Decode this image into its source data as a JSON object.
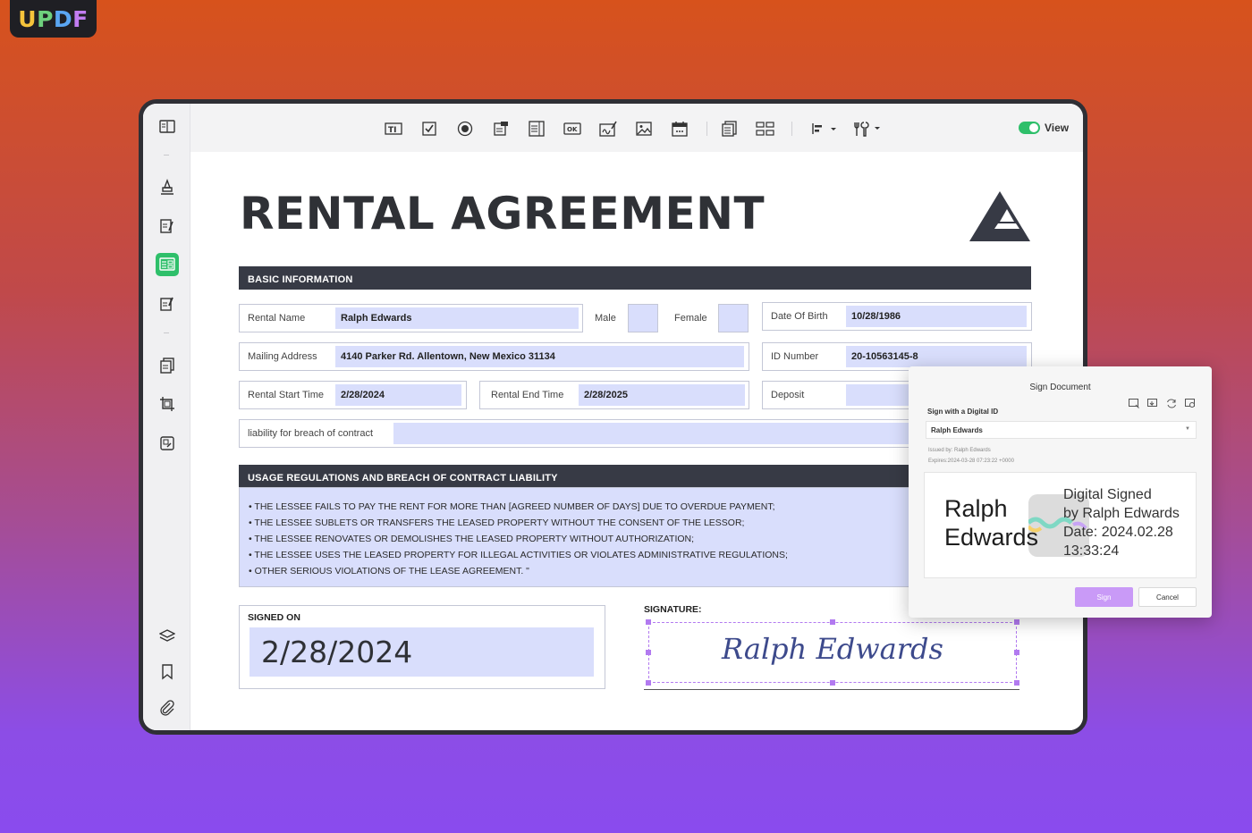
{
  "brand": {
    "letters": [
      "U",
      "P",
      "D",
      "F"
    ]
  },
  "toolbar": {
    "tools": [
      "text-field-icon",
      "checkbox-icon",
      "radio-button-icon",
      "dropdown-icon",
      "list-box-icon",
      "button-icon",
      "signature-field-icon",
      "image-field-icon",
      "date-field-icon",
      "form-recognition-icon",
      "grid-icon",
      "align-icon",
      "tools-icon"
    ],
    "view_label": "View",
    "view_enabled": true
  },
  "sidebar": {
    "items": [
      "reader-icon",
      "highlighter-icon",
      "edit-pdf-icon",
      "prepare-form-icon",
      "fill-sign-icon",
      "organize-pages-icon",
      "crop-icon",
      "page-tools-icon",
      "layers-icon",
      "bookmark-icon",
      "attachment-icon"
    ],
    "active": "prepare-form-icon"
  },
  "document": {
    "title": "RENTAL AGREEMENT",
    "basic_info_header": "BASIC INFORMATION",
    "rental_name_label": "Rental Name",
    "rental_name_value": "Ralph Edwards",
    "male_label": "Male",
    "female_label": "Female",
    "dob_label": "Date Of Birth",
    "dob_value": "10/28/1986",
    "mailing_label": "Mailing Address",
    "mailing_value": "4140 Parker Rd. Allentown, New Mexico 31134",
    "id_label": "ID Number",
    "id_value": "20-10563145-8",
    "start_label": "Rental Start Time",
    "start_value": "2/28/2024",
    "end_label": "Rental End Time",
    "end_value": "2/28/2025",
    "deposit_label": "Deposit",
    "liability_label": "liability for breach of contract",
    "usage_header": "USAGE REGULATIONS AND BREACH OF CONTRACT LIABILITY",
    "rules": [
      "THE LESSEE FAILS TO PAY THE RENT FOR MORE THAN [AGREED NUMBER OF DAYS] DUE TO OVERDUE PAYMENT;",
      "THE LESSEE SUBLETS OR TRANSFERS THE LEASED PROPERTY WITHOUT THE CONSENT OF THE LESSOR;",
      "THE LESSEE RENOVATES OR DEMOLISHES THE LEASED PROPERTY WITHOUT AUTHORIZATION;",
      "THE LESSEE USES THE LEASED PROPERTY FOR ILLEGAL ACTIVITIES OR VIOLATES ADMINISTRATIVE REGULATIONS;",
      "OTHER SERIOUS VIOLATIONS OF THE LEASE AGREEMENT. \""
    ],
    "signed_on_label": "SIGNED ON",
    "signed_on_value": "2/28/2024",
    "signature_label": "SIGNATURE:",
    "signature_value": "Ralph Edwards"
  },
  "dialog": {
    "title": "Sign Document",
    "subtitle": "Sign with a Digital ID",
    "selected_id": "Ralph Edwards",
    "issued_by": "Issued by: Ralph Edwards",
    "expires": "Expires:2024-03-28 07:23:22 +0000",
    "preview_name": "Ralph\nEdwards",
    "preview_info_lines": [
      "Digital Signed",
      "by Ralph Edwards",
      "Date: 2024.02.28",
      "13:33:24"
    ],
    "sign_label": "Sign",
    "cancel_label": "Cancel",
    "header_icons": [
      "add-id-icon",
      "import-id-icon",
      "refresh-icon",
      "manage-id-icon"
    ]
  }
}
